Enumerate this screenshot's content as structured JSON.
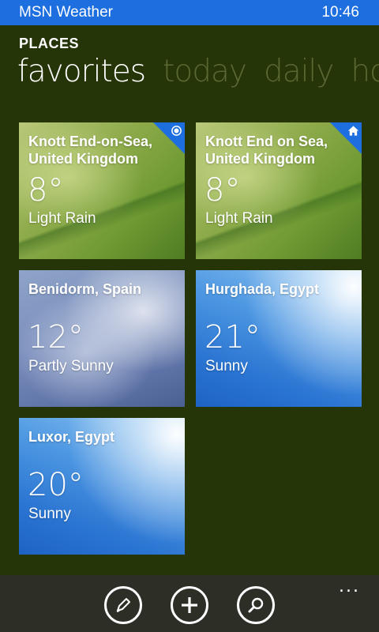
{
  "status_bar": {
    "app_name": "MSN Weather",
    "time": "10:46"
  },
  "pivot": {
    "title": "PLACES",
    "headers": [
      "favorites",
      "today",
      "daily",
      "hour"
    ]
  },
  "tiles": [
    {
      "city": "Knott End-on-Sea,\nUnited Kingdom",
      "temp": "8°",
      "condition": "Light Rain",
      "badge": "location-icon"
    },
    {
      "city": "Knott End on Sea,\nUnited Kingdom",
      "temp": "8°",
      "condition": "Light Rain",
      "badge": "home-icon"
    },
    {
      "city": "Benidorm, Spain",
      "temp": "12°",
      "condition": "Partly Sunny"
    },
    {
      "city": "Hurghada, Egypt",
      "temp": "21°",
      "condition": "Sunny"
    },
    {
      "city": "Luxor, Egypt",
      "temp": "20°",
      "condition": "Sunny"
    }
  ],
  "app_bar": {
    "buttons": [
      "edit-icon",
      "add-icon",
      "search-icon"
    ],
    "more": "..."
  },
  "colors": {
    "background": "#253508",
    "accent": "#1d6fe0",
    "app_bar": "#2d2f27"
  }
}
